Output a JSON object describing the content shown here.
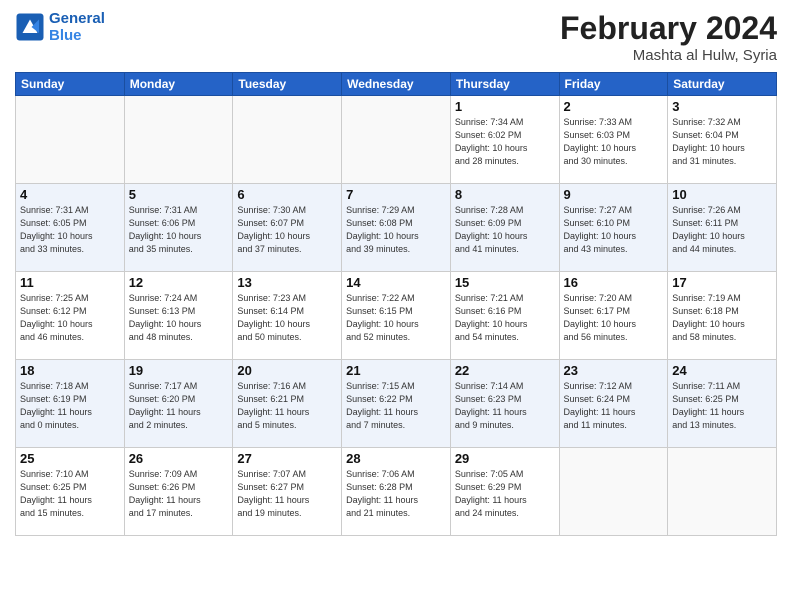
{
  "header": {
    "logo_line1": "General",
    "logo_line2": "Blue",
    "title": "February 2024",
    "location": "Mashta al Hulw, Syria"
  },
  "weekdays": [
    "Sunday",
    "Monday",
    "Tuesday",
    "Wednesday",
    "Thursday",
    "Friday",
    "Saturday"
  ],
  "weeks": [
    [
      {
        "day": "",
        "info": ""
      },
      {
        "day": "",
        "info": ""
      },
      {
        "day": "",
        "info": ""
      },
      {
        "day": "",
        "info": ""
      },
      {
        "day": "1",
        "info": "Sunrise: 7:34 AM\nSunset: 6:02 PM\nDaylight: 10 hours\nand 28 minutes."
      },
      {
        "day": "2",
        "info": "Sunrise: 7:33 AM\nSunset: 6:03 PM\nDaylight: 10 hours\nand 30 minutes."
      },
      {
        "day": "3",
        "info": "Sunrise: 7:32 AM\nSunset: 6:04 PM\nDaylight: 10 hours\nand 31 minutes."
      }
    ],
    [
      {
        "day": "4",
        "info": "Sunrise: 7:31 AM\nSunset: 6:05 PM\nDaylight: 10 hours\nand 33 minutes."
      },
      {
        "day": "5",
        "info": "Sunrise: 7:31 AM\nSunset: 6:06 PM\nDaylight: 10 hours\nand 35 minutes."
      },
      {
        "day": "6",
        "info": "Sunrise: 7:30 AM\nSunset: 6:07 PM\nDaylight: 10 hours\nand 37 minutes."
      },
      {
        "day": "7",
        "info": "Sunrise: 7:29 AM\nSunset: 6:08 PM\nDaylight: 10 hours\nand 39 minutes."
      },
      {
        "day": "8",
        "info": "Sunrise: 7:28 AM\nSunset: 6:09 PM\nDaylight: 10 hours\nand 41 minutes."
      },
      {
        "day": "9",
        "info": "Sunrise: 7:27 AM\nSunset: 6:10 PM\nDaylight: 10 hours\nand 43 minutes."
      },
      {
        "day": "10",
        "info": "Sunrise: 7:26 AM\nSunset: 6:11 PM\nDaylight: 10 hours\nand 44 minutes."
      }
    ],
    [
      {
        "day": "11",
        "info": "Sunrise: 7:25 AM\nSunset: 6:12 PM\nDaylight: 10 hours\nand 46 minutes."
      },
      {
        "day": "12",
        "info": "Sunrise: 7:24 AM\nSunset: 6:13 PM\nDaylight: 10 hours\nand 48 minutes."
      },
      {
        "day": "13",
        "info": "Sunrise: 7:23 AM\nSunset: 6:14 PM\nDaylight: 10 hours\nand 50 minutes."
      },
      {
        "day": "14",
        "info": "Sunrise: 7:22 AM\nSunset: 6:15 PM\nDaylight: 10 hours\nand 52 minutes."
      },
      {
        "day": "15",
        "info": "Sunrise: 7:21 AM\nSunset: 6:16 PM\nDaylight: 10 hours\nand 54 minutes."
      },
      {
        "day": "16",
        "info": "Sunrise: 7:20 AM\nSunset: 6:17 PM\nDaylight: 10 hours\nand 56 minutes."
      },
      {
        "day": "17",
        "info": "Sunrise: 7:19 AM\nSunset: 6:18 PM\nDaylight: 10 hours\nand 58 minutes."
      }
    ],
    [
      {
        "day": "18",
        "info": "Sunrise: 7:18 AM\nSunset: 6:19 PM\nDaylight: 11 hours\nand 0 minutes."
      },
      {
        "day": "19",
        "info": "Sunrise: 7:17 AM\nSunset: 6:20 PM\nDaylight: 11 hours\nand 2 minutes."
      },
      {
        "day": "20",
        "info": "Sunrise: 7:16 AM\nSunset: 6:21 PM\nDaylight: 11 hours\nand 5 minutes."
      },
      {
        "day": "21",
        "info": "Sunrise: 7:15 AM\nSunset: 6:22 PM\nDaylight: 11 hours\nand 7 minutes."
      },
      {
        "day": "22",
        "info": "Sunrise: 7:14 AM\nSunset: 6:23 PM\nDaylight: 11 hours\nand 9 minutes."
      },
      {
        "day": "23",
        "info": "Sunrise: 7:12 AM\nSunset: 6:24 PM\nDaylight: 11 hours\nand 11 minutes."
      },
      {
        "day": "24",
        "info": "Sunrise: 7:11 AM\nSunset: 6:25 PM\nDaylight: 11 hours\nand 13 minutes."
      }
    ],
    [
      {
        "day": "25",
        "info": "Sunrise: 7:10 AM\nSunset: 6:25 PM\nDaylight: 11 hours\nand 15 minutes."
      },
      {
        "day": "26",
        "info": "Sunrise: 7:09 AM\nSunset: 6:26 PM\nDaylight: 11 hours\nand 17 minutes."
      },
      {
        "day": "27",
        "info": "Sunrise: 7:07 AM\nSunset: 6:27 PM\nDaylight: 11 hours\nand 19 minutes."
      },
      {
        "day": "28",
        "info": "Sunrise: 7:06 AM\nSunset: 6:28 PM\nDaylight: 11 hours\nand 21 minutes."
      },
      {
        "day": "29",
        "info": "Sunrise: 7:05 AM\nSunset: 6:29 PM\nDaylight: 11 hours\nand 24 minutes."
      },
      {
        "day": "",
        "info": ""
      },
      {
        "day": "",
        "info": ""
      }
    ]
  ]
}
